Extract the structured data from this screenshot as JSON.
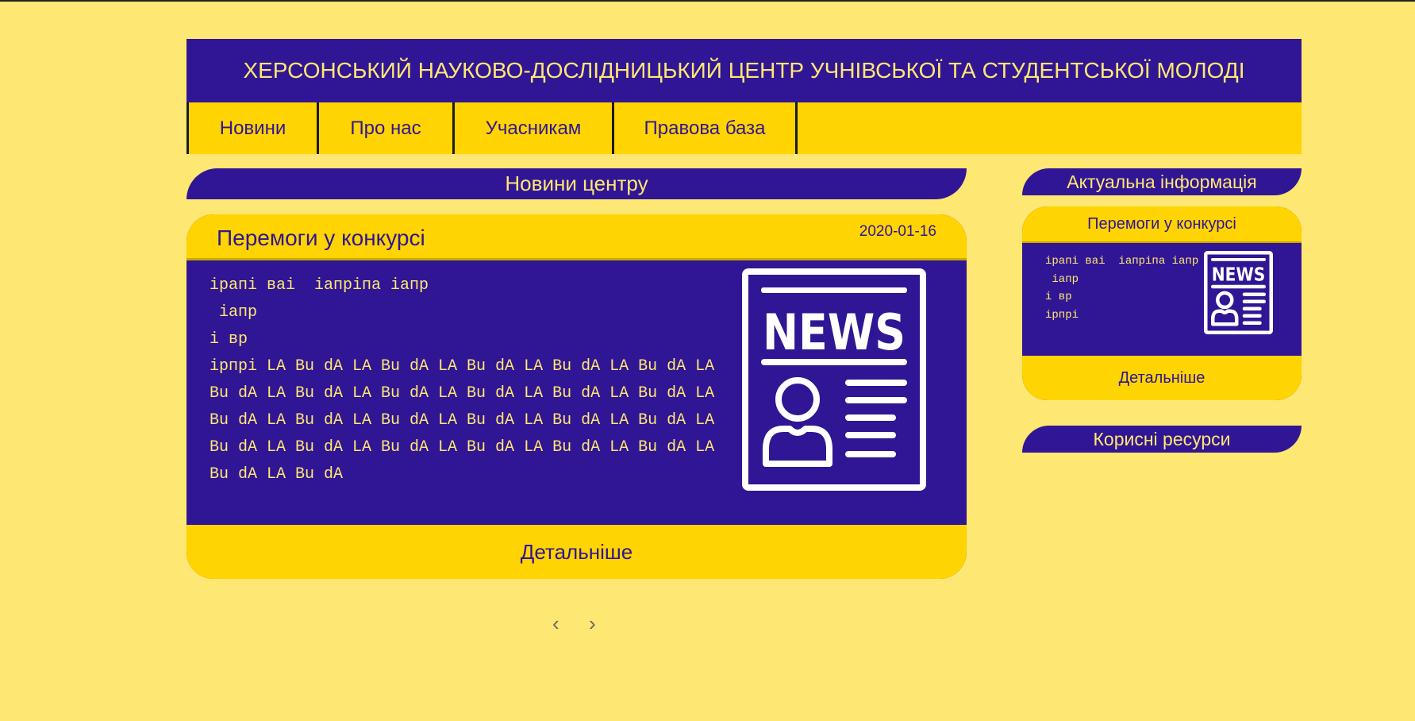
{
  "site": {
    "title": "ХЕРСОНСЬКИЙ НАУКОВО-ДОСЛІДНИЦЬКИЙ ЦЕНТР УЧНІВСЬКОЇ ТА СТУДЕНТСЬКОЇ МОЛОДІ"
  },
  "nav": {
    "items": [
      {
        "label": "Новини"
      },
      {
        "label": "Про нас"
      },
      {
        "label": "Учасникам"
      },
      {
        "label": "Правова база"
      }
    ]
  },
  "main": {
    "section_title": "Новини центру",
    "news": {
      "headline": "Перемоги у конкурсі",
      "date": "2020-01-16",
      "body": "ірапі ваі  іапріпа іапр\n іапр\nі вр\nірпрі LA Bu dA LA Bu dA LA Bu dA LA Bu dA LA Bu dA LA Bu dA LA Bu dA LA Bu dA LA Bu dA LA Bu dA LA Bu dA LA Bu dA LA Bu dA LA Bu dA LA Bu dA LA Bu dA LA Bu dA LA Bu dA LA Bu dA LA Bu dA LA Bu dA LA Bu dA LA Bu dA LA Bu dA LA Bu dA",
      "more_label": "Детальніше",
      "image_text": "NEWS"
    },
    "pager": {
      "prev": "‹",
      "next": "›"
    }
  },
  "sidebar": {
    "section_title": "Актуальна інформація",
    "card": {
      "headline": "Перемоги у конкурсі",
      "body": "ірапі ваі  іапріпа іапр\n іапр\nі вр\nірпрі",
      "more_label": "Детальніше",
      "image_text": "NEWS"
    },
    "resources_title": "Корисні ресурси"
  },
  "colors": {
    "background": "#FFE773",
    "primary": "#301694",
    "accent": "#FFD400"
  }
}
